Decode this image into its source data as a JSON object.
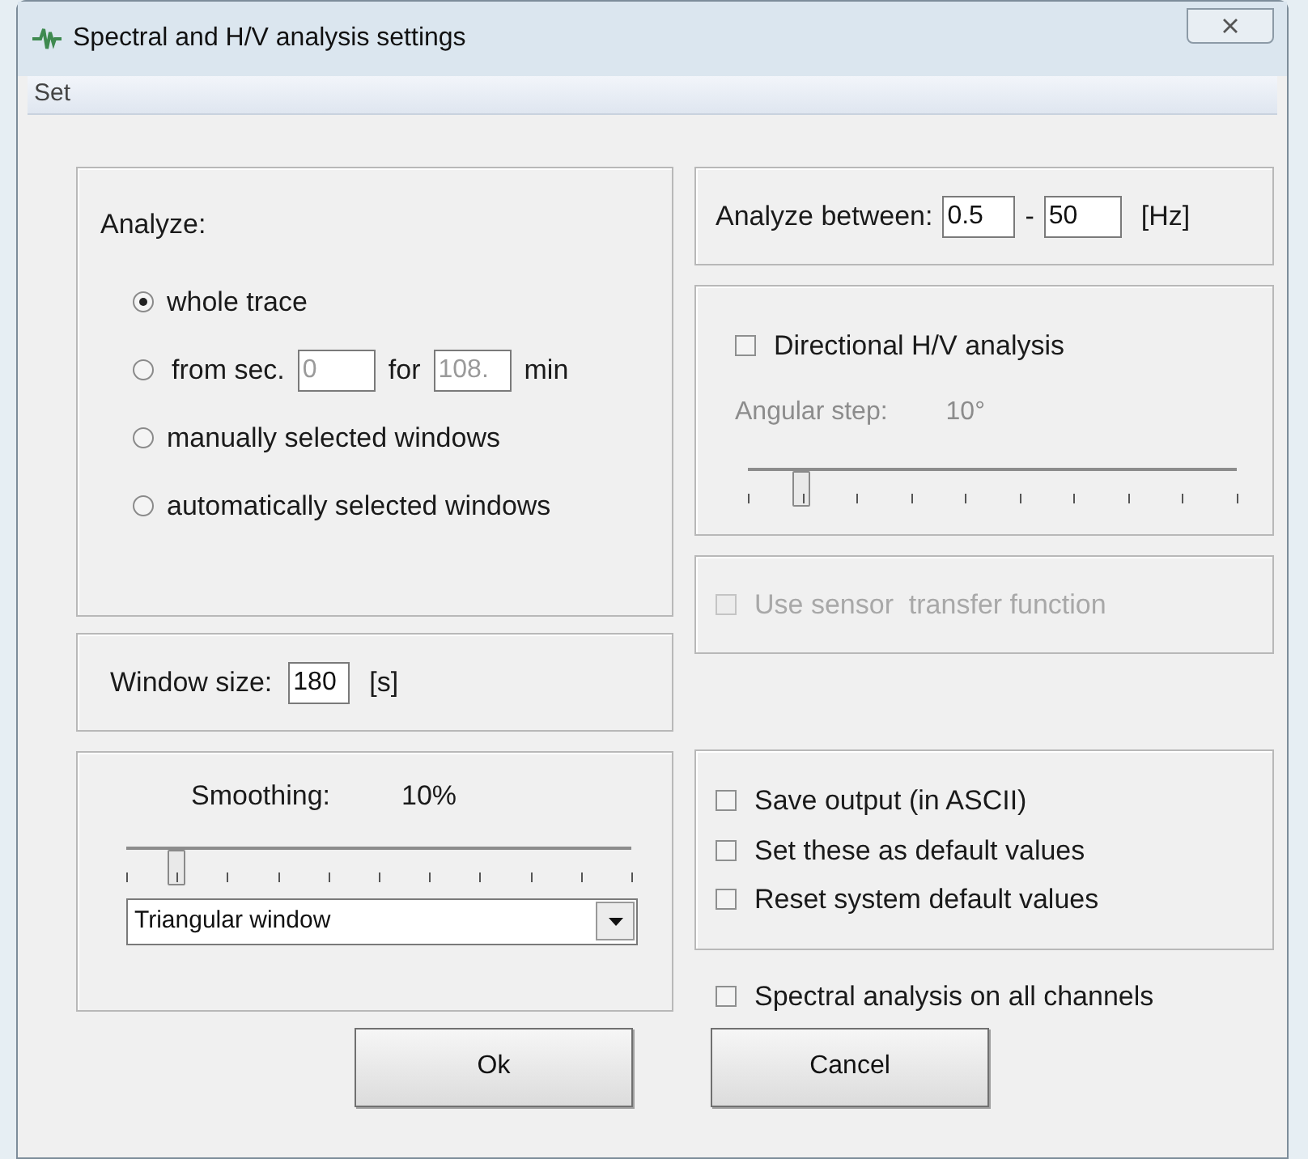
{
  "window": {
    "title": "Spectral and H/V analysis settings"
  },
  "menu": [
    {
      "label": "Set"
    }
  ],
  "analyze": {
    "label": "Analyze:",
    "options": [
      {
        "kind": "plain",
        "label": "whole trace",
        "selected": true
      },
      {
        "kind": "range",
        "label": "from sec.",
        "from_value": "0",
        "middle": "for",
        "duration_value": "108.",
        "unit": "min",
        "selected": false,
        "fields_disabled": true
      },
      {
        "kind": "plain",
        "label": "manually selected windows",
        "selected": false
      },
      {
        "kind": "plain",
        "label": "automatically selected windows",
        "selected": false
      }
    ]
  },
  "window_size": {
    "label": "Window size:",
    "value": "180",
    "unit": "[s]"
  },
  "smoothing": {
    "label": "Smoothing:",
    "reading": "10%",
    "level": 0.1,
    "window_type": "Triangular window"
  },
  "frequency_range": {
    "label": "Analyze between:",
    "from": "0.5",
    "separator": "-",
    "to": "50",
    "unit": "[Hz]"
  },
  "directional": {
    "label": "Directional H/V analysis",
    "checked": false,
    "step_label": "Angular step:",
    "step_reading": "10°",
    "level": 0.11,
    "disabled": true
  },
  "sensor": {
    "label": "Use sensor  transfer function",
    "checked": false,
    "disabled": true
  },
  "options": [
    {
      "label": "Save output (in ASCII)",
      "checked": false
    },
    {
      "label": "Set these as default values",
      "checked": false
    },
    {
      "label": "Reset system default values",
      "checked": false
    }
  ],
  "all_channels": {
    "label": "Spectral analysis on all channels",
    "checked": false
  },
  "buttons": [
    {
      "label": "Ok"
    },
    {
      "label": "Cancel"
    }
  ]
}
